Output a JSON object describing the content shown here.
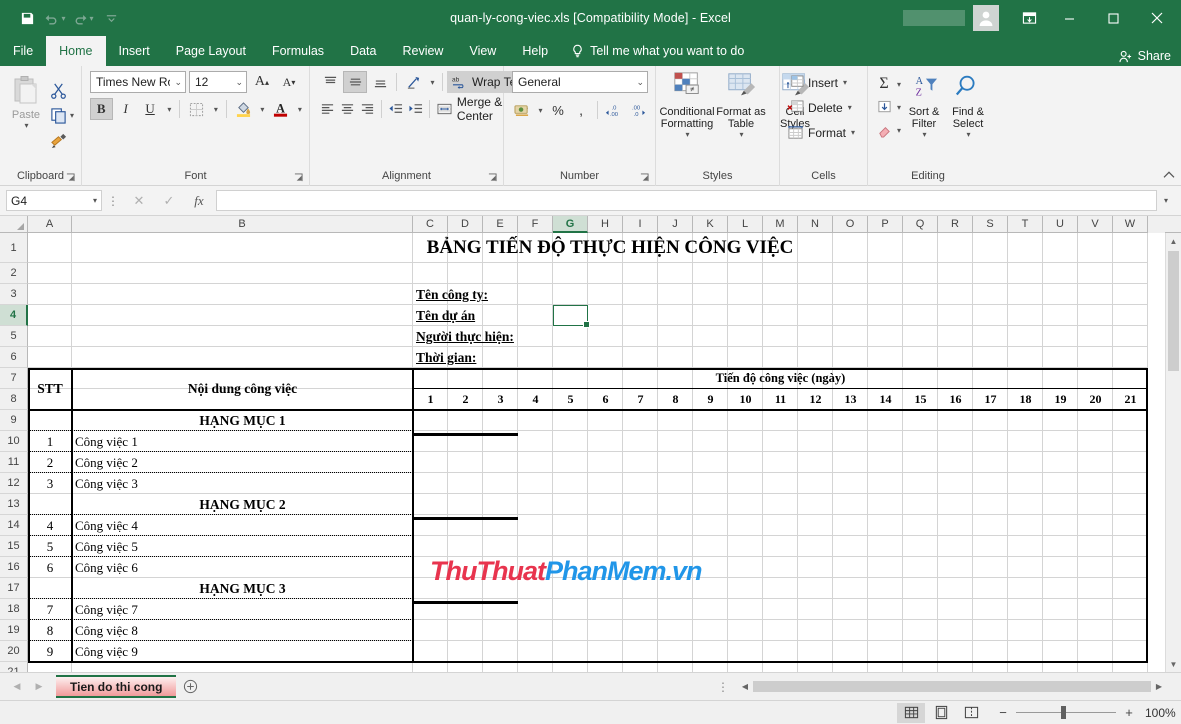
{
  "titlebar": {
    "filename": "quan-ly-cong-viec.xls [Compatibility Mode]  -  Excel",
    "qat": [
      {
        "name": "save-icon",
        "label": "Save"
      },
      {
        "name": "undo-icon",
        "label": "Undo"
      },
      {
        "name": "redo-icon",
        "label": "Redo"
      },
      {
        "name": "customize-qat-icon",
        "label": "Customize Quick Access Toolbar"
      }
    ],
    "window_buttons": [
      "minimize",
      "restore",
      "close"
    ],
    "ribbon_display_label": "Ribbon Display Options"
  },
  "tabs": {
    "items": [
      "File",
      "Home",
      "Insert",
      "Page Layout",
      "Formulas",
      "Data",
      "Review",
      "View",
      "Help"
    ],
    "active": "Home",
    "tellme": "Tell me what you want to do",
    "share": "Share"
  },
  "ribbon": {
    "clipboard": {
      "label": "Clipboard",
      "paste": "Paste",
      "cut": "Cut",
      "copy": "Copy",
      "format_painter": "Format Painter"
    },
    "font": {
      "label": "Font",
      "family": "Times New Ro",
      "size": "12",
      "grow": "A",
      "shrink": "A",
      "bold": "B",
      "italic": "I",
      "underline": "U",
      "borders": "Borders",
      "fill_color": "Fill Color",
      "font_color": "A"
    },
    "alignment": {
      "label": "Alignment",
      "wrap_text": "Wrap Text",
      "merge_center": "Merge & Center"
    },
    "number": {
      "label": "Number",
      "format": "General",
      "percent": "%",
      "comma": ",",
      "decrease_decimal": "Decrease Decimal",
      "increase_decimal": "Increase Decimal"
    },
    "styles": {
      "label": "Styles",
      "conditional_formatting": "Conditional Formatting",
      "format_as_table": "Format as Table",
      "cell_styles": "Cell Styles"
    },
    "cells": {
      "label": "Cells",
      "insert": "Insert",
      "delete": "Delete",
      "format": "Format"
    },
    "editing": {
      "label": "Editing",
      "autosum": "AutoSum",
      "fill": "Fill",
      "clear": "Clear",
      "sort_filter": "Sort & Filter",
      "find_select": "Find & Select"
    }
  },
  "formula_bar": {
    "name_box": "G4",
    "formula": "",
    "cancel": "Cancel",
    "enter": "Enter",
    "insert_function": "fx"
  },
  "grid": {
    "columns": [
      "A",
      "B",
      "C",
      "D",
      "E",
      "F",
      "G",
      "H",
      "I",
      "J",
      "K",
      "L",
      "M",
      "N",
      "O",
      "P",
      "Q",
      "R",
      "S",
      "T",
      "U",
      "V",
      "W"
    ],
    "selected_column": "G",
    "rows": [
      1,
      2,
      3,
      4,
      5,
      6,
      7,
      8,
      9,
      10,
      11,
      12,
      13,
      14,
      15,
      16,
      17,
      18,
      19,
      20,
      21
    ],
    "selected_row": 4,
    "selected_cell": "G4"
  },
  "sheet_content": {
    "title": "BẢNG TIẾN ĐỘ THỰC HIỆN CÔNG VIỆC",
    "info_labels": [
      "Tên công ty:",
      "Tên dự án",
      "Người thực hiện:",
      "Thời gian:"
    ],
    "table_headers": {
      "stt": "STT",
      "content": "Nội dung công việc",
      "progress": "Tiến độ công việc (ngày)"
    },
    "day_numbers": [
      "1",
      "2",
      "3",
      "4",
      "5",
      "6",
      "7",
      "8",
      "9",
      "10",
      "11",
      "12",
      "13",
      "14",
      "15",
      "16",
      "17",
      "18",
      "19",
      "20",
      "21"
    ],
    "sections": [
      {
        "heading": "HẠNG MỤC 1",
        "tasks": [
          {
            "stt": "1",
            "name": "Công việc 1",
            "bar_start": 1,
            "bar_end": 3
          },
          {
            "stt": "2",
            "name": "Công việc 2",
            "bar_start": 0,
            "bar_end": 0
          },
          {
            "stt": "3",
            "name": "Công việc 3",
            "bar_start": 0,
            "bar_end": 0
          }
        ]
      },
      {
        "heading": "HẠNG MỤC 2",
        "tasks": [
          {
            "stt": "4",
            "name": "Công việc 4",
            "bar_start": 1,
            "bar_end": 3
          },
          {
            "stt": "5",
            "name": "Công việc 5",
            "bar_start": 0,
            "bar_end": 0
          },
          {
            "stt": "6",
            "name": "Công việc 6",
            "bar_start": 0,
            "bar_end": 0
          }
        ]
      },
      {
        "heading": "HẠNG MỤC 3",
        "tasks": [
          {
            "stt": "7",
            "name": "Công việc 7",
            "bar_start": 1,
            "bar_end": 3
          },
          {
            "stt": "8",
            "name": "Công việc 8",
            "bar_start": 0,
            "bar_end": 0
          },
          {
            "stt": "9",
            "name": "Công việc 9",
            "bar_start": 0,
            "bar_end": 0
          }
        ]
      }
    ],
    "watermark": {
      "part1": "ThuThuat",
      "part2": "PhanMem",
      "part3": ".vn"
    }
  },
  "sheet_tabs": {
    "tabs": [
      "Tien do thi cong"
    ],
    "active": "Tien do thi cong",
    "add_label": "New sheet"
  },
  "status_bar": {
    "views": [
      "Normal",
      "Page Layout",
      "Page Break Preview"
    ],
    "active_view": "Normal",
    "zoom": "100%",
    "zoom_out": "−",
    "zoom_in": "+"
  },
  "colors": {
    "accent": "#217346",
    "watermark_red": "#e8344e",
    "watermark_blue": "#2196e8"
  }
}
